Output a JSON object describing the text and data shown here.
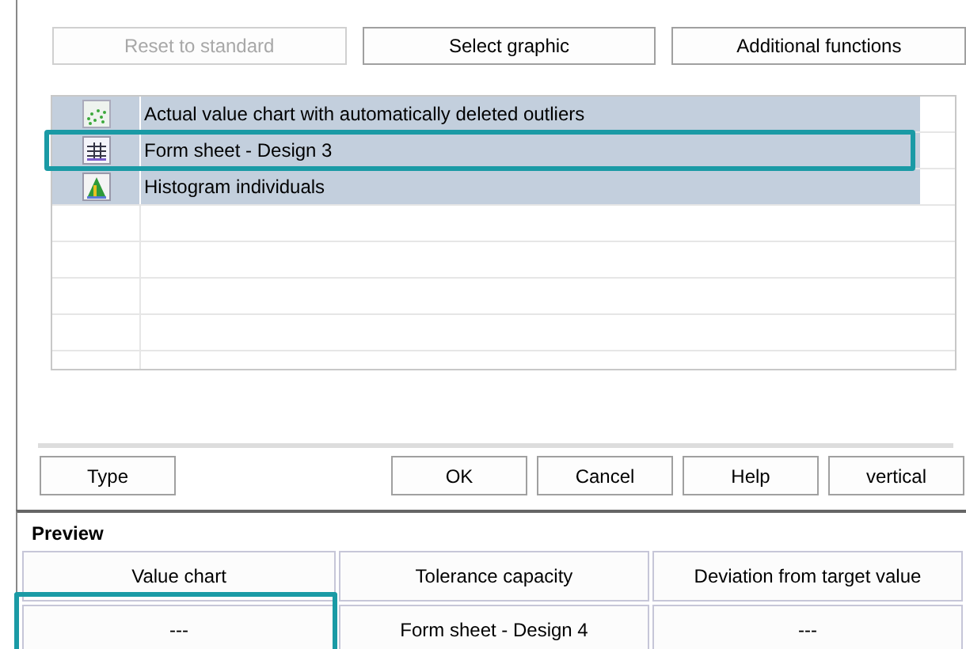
{
  "top_buttons": [
    {
      "label": "Reset to standard",
      "disabled": true
    },
    {
      "label": "Select graphic",
      "disabled": false
    },
    {
      "label": "Additional functions",
      "disabled": false
    }
  ],
  "graphics_list": [
    {
      "label": "Actual value chart with automatically deleted outliers",
      "kind": "value-chart",
      "selected": true,
      "highlighted": false
    },
    {
      "label": "Form sheet - Design 3",
      "kind": "form-sheet",
      "selected": true,
      "highlighted": true
    },
    {
      "label": "Histogram individuals",
      "kind": "histogram",
      "selected": true,
      "highlighted": false
    }
  ],
  "bottom_buttons": [
    {
      "label": "Type"
    },
    {
      "label": "OK"
    },
    {
      "label": "Cancel"
    },
    {
      "label": "Help"
    },
    {
      "label": "vertical"
    }
  ],
  "preview": {
    "title": "Preview",
    "headers": [
      "Value chart",
      "Tolerance capacity",
      "Deviation from target value"
    ],
    "cells": [
      {
        "text": "---",
        "highlighted": true
      },
      {
        "text": "Form sheet - Design 4",
        "highlighted": false
      },
      {
        "text": "---",
        "highlighted": false
      }
    ]
  }
}
